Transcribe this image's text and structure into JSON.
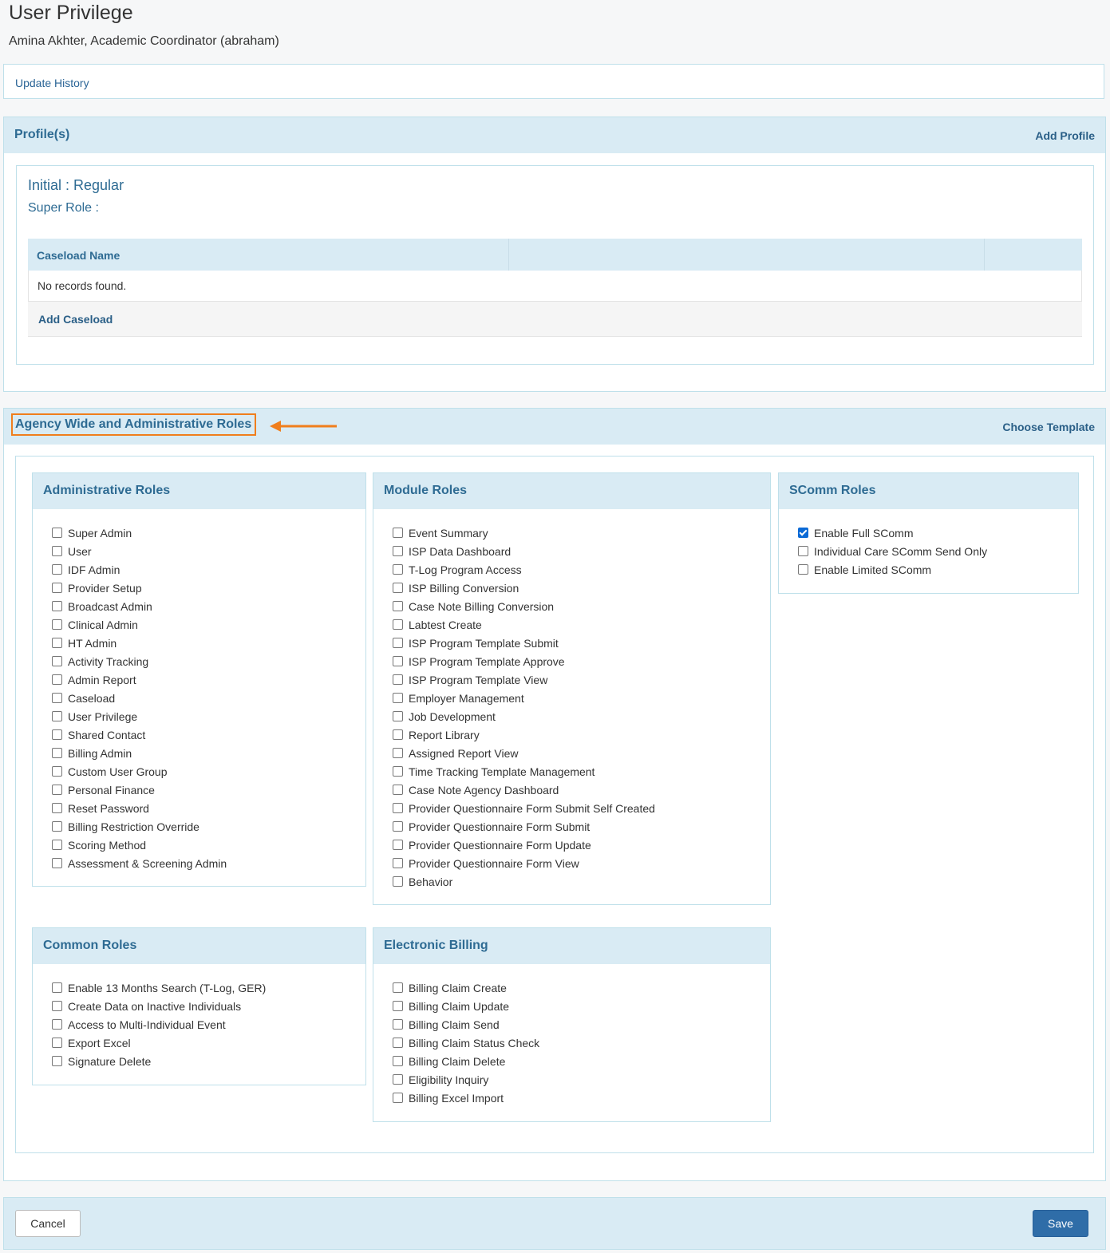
{
  "page": {
    "title": "User Privilege",
    "subtitle": "Amina Akhter, Academic Coordinator (abraham)",
    "update_history": "Update History"
  },
  "profiles": {
    "title": "Profile(s)",
    "add_profile": "Add Profile",
    "initial": "Initial : Regular",
    "super_role": "Super Role :",
    "caseload_header": "Caseload Name",
    "empty_text": "No records found.",
    "add_caseload": "Add Caseload"
  },
  "agency": {
    "title": "Agency Wide and Administrative Roles",
    "choose_template": "Choose Template",
    "highlight_color": "#f07e1c",
    "administrative": {
      "title": "Administrative Roles",
      "items": [
        {
          "label": "Super Admin",
          "checked": false
        },
        {
          "label": "User",
          "checked": false
        },
        {
          "label": "IDF Admin",
          "checked": false
        },
        {
          "label": "Provider Setup",
          "checked": false
        },
        {
          "label": "Broadcast Admin",
          "checked": false
        },
        {
          "label": "Clinical Admin",
          "checked": false
        },
        {
          "label": "HT Admin",
          "checked": false
        },
        {
          "label": "Activity Tracking",
          "checked": false
        },
        {
          "label": "Admin Report",
          "checked": false
        },
        {
          "label": "Caseload",
          "checked": false
        },
        {
          "label": "User Privilege",
          "checked": false
        },
        {
          "label": "Shared Contact",
          "checked": false
        },
        {
          "label": "Billing Admin",
          "checked": false
        },
        {
          "label": "Custom User Group",
          "checked": false
        },
        {
          "label": "Personal Finance",
          "checked": false
        },
        {
          "label": "Reset Password",
          "checked": false
        },
        {
          "label": "Billing Restriction Override",
          "checked": false
        },
        {
          "label": "Scoring Method",
          "checked": false
        },
        {
          "label": "Assessment & Screening Admin",
          "checked": false
        }
      ]
    },
    "module": {
      "title": "Module Roles",
      "items": [
        {
          "label": "Event Summary",
          "checked": false
        },
        {
          "label": "ISP Data Dashboard",
          "checked": false
        },
        {
          "label": "T-Log Program Access",
          "checked": false
        },
        {
          "label": "ISP Billing Conversion",
          "checked": false
        },
        {
          "label": "Case Note Billing Conversion",
          "checked": false
        },
        {
          "label": "Labtest Create",
          "checked": false
        },
        {
          "label": "ISP Program Template Submit",
          "checked": false
        },
        {
          "label": "ISP Program Template Approve",
          "checked": false
        },
        {
          "label": "ISP Program Template View",
          "checked": false
        },
        {
          "label": "Employer Management",
          "checked": false
        },
        {
          "label": "Job Development",
          "checked": false
        },
        {
          "label": "Report Library",
          "checked": false
        },
        {
          "label": "Assigned Report View",
          "checked": false
        },
        {
          "label": "Time Tracking Template Management",
          "checked": false
        },
        {
          "label": "Case Note Agency Dashboard",
          "checked": false
        },
        {
          "label": "Provider Questionnaire Form Submit Self Created",
          "checked": false
        },
        {
          "label": "Provider Questionnaire Form Submit",
          "checked": false
        },
        {
          "label": "Provider Questionnaire Form Update",
          "checked": false
        },
        {
          "label": "Provider Questionnaire Form View",
          "checked": false
        },
        {
          "label": "Behavior",
          "checked": false
        }
      ]
    },
    "scomm": {
      "title": "SComm Roles",
      "items": [
        {
          "label": "Enable Full SComm",
          "checked": true
        },
        {
          "label": "Individual Care SComm Send Only",
          "checked": false
        },
        {
          "label": "Enable Limited SComm",
          "checked": false
        }
      ]
    },
    "common": {
      "title": "Common Roles",
      "items": [
        {
          "label": "Enable 13 Months Search (T-Log, GER)",
          "checked": false
        },
        {
          "label": "Create Data on Inactive Individuals",
          "checked": false
        },
        {
          "label": "Access to Multi-Individual Event",
          "checked": false
        },
        {
          "label": "Export Excel",
          "checked": false
        },
        {
          "label": "Signature Delete",
          "checked": false
        }
      ]
    },
    "billing": {
      "title": "Electronic Billing",
      "items": [
        {
          "label": "Billing Claim Create",
          "checked": false
        },
        {
          "label": "Billing Claim Update",
          "checked": false
        },
        {
          "label": "Billing Claim Send",
          "checked": false
        },
        {
          "label": "Billing Claim Status Check",
          "checked": false
        },
        {
          "label": "Billing Claim Delete",
          "checked": false
        },
        {
          "label": "Eligibility Inquiry",
          "checked": false
        },
        {
          "label": "Billing Excel Import",
          "checked": false
        }
      ]
    }
  },
  "footer": {
    "cancel": "Cancel",
    "save": "Save",
    "save_color": "#2f6da8"
  }
}
